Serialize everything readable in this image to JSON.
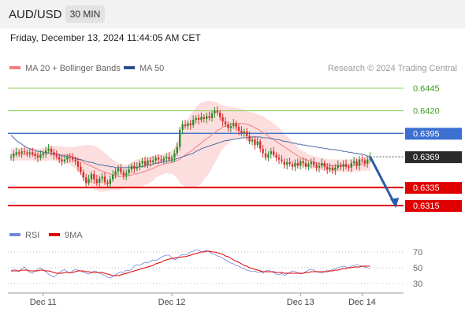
{
  "header": {
    "pair": "AUD/USD",
    "timeframe": "30 MIN"
  },
  "datetime": "Friday, December 13, 2024 11:44:05 AM CET",
  "watermark": "Research © 2024 Trading Central",
  "colors": {
    "resistance": "#8ccf5a",
    "pivot": "#3b6fd1",
    "support": "#e00000",
    "current": "#2b2b2b",
    "up": "#2f8a2f",
    "down": "#d92e2e",
    "ma20": "#f08080",
    "ma50": "#4d6fa8",
    "band": "#fdd8d8",
    "rsi": "#6f88d8",
    "ma9": "#e00000",
    "arrow": "#2a5caa"
  },
  "chart_data": [
    {
      "type": "candlestick",
      "legend": [
        {
          "label": "MA 20 + Bollinger Bands",
          "color": "#f08080"
        },
        {
          "label": "MA 50",
          "color": "#2a4f8f"
        }
      ],
      "ylim": [
        0.6308,
        0.6452
      ],
      "x_ticks": [
        {
          "i": 12,
          "label": "Dec 11"
        },
        {
          "i": 60,
          "label": "Dec 12"
        },
        {
          "i": 108,
          "label": "Dec 13"
        },
        {
          "i": 131,
          "label": "Dec 14"
        }
      ],
      "levels": [
        {
          "value": 0.6445,
          "label": "0.6445",
          "kind": "resistance"
        },
        {
          "value": 0.642,
          "label": "0.6420",
          "kind": "resistance"
        },
        {
          "value": 0.6395,
          "label": "0.6395",
          "kind": "pivot"
        },
        {
          "value": 0.6369,
          "label": "0.6369",
          "kind": "current"
        },
        {
          "value": 0.6335,
          "label": "0.6335",
          "kind": "support"
        },
        {
          "value": 0.6315,
          "label": "0.6315",
          "kind": "support"
        }
      ],
      "close": [
        0.6369,
        0.6372,
        0.6374,
        0.6373,
        0.6375,
        0.6374,
        0.6373,
        0.6374,
        0.6372,
        0.637,
        0.6368,
        0.6371,
        0.6373,
        0.6376,
        0.6378,
        0.6374,
        0.6371,
        0.6369,
        0.6366,
        0.6364,
        0.6366,
        0.6369,
        0.6368,
        0.6366,
        0.6364,
        0.6358,
        0.6352,
        0.6346,
        0.634,
        0.6344,
        0.635,
        0.6344,
        0.634,
        0.6345,
        0.6347,
        0.6341,
        0.6339,
        0.6344,
        0.6349,
        0.6353,
        0.6356,
        0.6352,
        0.6348,
        0.6351,
        0.6355,
        0.6359,
        0.6356,
        0.6358,
        0.6362,
        0.6364,
        0.636,
        0.6365,
        0.6363,
        0.6365,
        0.6368,
        0.6366,
        0.6365,
        0.6367,
        0.6369,
        0.6366,
        0.6368,
        0.6373,
        0.638,
        0.6399,
        0.6405,
        0.6403,
        0.6406,
        0.6404,
        0.641,
        0.6412,
        0.641,
        0.6413,
        0.6411,
        0.6414,
        0.6412,
        0.6417,
        0.642,
        0.6418,
        0.6413,
        0.6408,
        0.6405,
        0.6401,
        0.6403,
        0.6406,
        0.6402,
        0.6398,
        0.6395,
        0.6397,
        0.6392,
        0.6386,
        0.6388,
        0.6382,
        0.6386,
        0.6378,
        0.6373,
        0.6368,
        0.6372,
        0.6375,
        0.6371,
        0.6368,
        0.6366,
        0.6364,
        0.636,
        0.6363,
        0.6361,
        0.6358,
        0.6362,
        0.6359,
        0.6364,
        0.6362,
        0.6358,
        0.6361,
        0.6363,
        0.636,
        0.6357,
        0.6359,
        0.6362,
        0.6358,
        0.6355,
        0.6357,
        0.6354,
        0.6357,
        0.636,
        0.6358,
        0.6361,
        0.6358,
        0.6357,
        0.6362,
        0.6364,
        0.6359,
        0.6366,
        0.6365,
        0.6362,
        0.6366,
        0.6369
      ],
      "ma20": [
        0.6371,
        0.6372,
        0.6372,
        0.6372,
        0.6372,
        0.6372,
        0.6372,
        0.6372,
        0.6372,
        0.6371,
        0.6371,
        0.6371,
        0.6372,
        0.6372,
        0.6373,
        0.6373,
        0.6373,
        0.6372,
        0.6372,
        0.6371,
        0.6371,
        0.6371,
        0.637,
        0.6369,
        0.6368,
        0.6367,
        0.6365,
        0.6363,
        0.6361,
        0.636,
        0.6359,
        0.6357,
        0.6356,
        0.6354,
        0.6353,
        0.6352,
        0.6351,
        0.635,
        0.6349,
        0.6348,
        0.6347,
        0.6347,
        0.6347,
        0.6347,
        0.6348,
        0.6349,
        0.635,
        0.635,
        0.6351,
        0.6352,
        0.6353,
        0.6354,
        0.6355,
        0.6356,
        0.6358,
        0.6359,
        0.636,
        0.6361,
        0.6362,
        0.6362,
        0.6363,
        0.6364,
        0.6365,
        0.6366,
        0.6369,
        0.6371,
        0.6373,
        0.6375,
        0.6377,
        0.638,
        0.6382,
        0.6384,
        0.6387,
        0.6389,
        0.6391,
        0.6394,
        0.6396,
        0.6398,
        0.64,
        0.6402,
        0.6403,
        0.6404,
        0.6405,
        0.6406,
        0.6406,
        0.6406,
        0.6406,
        0.6406,
        0.6405,
        0.6404,
        0.6403,
        0.6401,
        0.64,
        0.6398,
        0.6396,
        0.6394,
        0.6392,
        0.639,
        0.6388,
        0.6386,
        0.6384,
        0.6382,
        0.638,
        0.6378,
        0.6376,
        0.6374,
        0.6372,
        0.637,
        0.6368,
        0.6367,
        0.6366,
        0.6365,
        0.6364,
        0.6363,
        0.6362,
        0.6361,
        0.6361,
        0.636,
        0.636,
        0.6359,
        0.6359,
        0.6359,
        0.6359,
        0.6359,
        0.6359,
        0.6359,
        0.6359,
        0.6359,
        0.636,
        0.636,
        0.636,
        0.6361,
        0.6361,
        0.6362,
        0.6362
      ],
      "bb_upper": [
        0.6378,
        0.6379,
        0.6379,
        0.6379,
        0.6379,
        0.6379,
        0.6379,
        0.6379,
        0.6379,
        0.6378,
        0.6378,
        0.6378,
        0.6379,
        0.638,
        0.6381,
        0.6381,
        0.6381,
        0.6381,
        0.6381,
        0.6381,
        0.638,
        0.638,
        0.638,
        0.638,
        0.638,
        0.6381,
        0.6381,
        0.6382,
        0.6382,
        0.6382,
        0.6382,
        0.6381,
        0.638,
        0.6378,
        0.6376,
        0.6373,
        0.6371,
        0.6368,
        0.6366,
        0.6364,
        0.6362,
        0.6361,
        0.636,
        0.636,
        0.6361,
        0.6363,
        0.6365,
        0.6366,
        0.6367,
        0.6368,
        0.6368,
        0.6369,
        0.6369,
        0.637,
        0.637,
        0.6371,
        0.6371,
        0.6372,
        0.6373,
        0.6374,
        0.6376,
        0.638,
        0.6385,
        0.6392,
        0.64,
        0.6406,
        0.6411,
        0.6416,
        0.642,
        0.6424,
        0.6427,
        0.6429,
        0.643,
        0.6431,
        0.6431,
        0.6431,
        0.643,
        0.6429,
        0.6427,
        0.6426,
        0.6425,
        0.6425,
        0.6424,
        0.6424,
        0.6423,
        0.6423,
        0.6422,
        0.6421,
        0.642,
        0.6419,
        0.6418,
        0.6417,
        0.6416,
        0.6415,
        0.6414,
        0.6412,
        0.641,
        0.6408,
        0.6406,
        0.6404,
        0.6401,
        0.6398,
        0.6395,
        0.6392,
        0.6389,
        0.6386,
        0.6383,
        0.638,
        0.6377,
        0.6375,
        0.6374,
        0.6372,
        0.6371,
        0.637,
        0.6369,
        0.6368,
        0.6368,
        0.6367,
        0.6367,
        0.6366,
        0.6366,
        0.6366,
        0.6366,
        0.6366,
        0.6366,
        0.6366,
        0.6366,
        0.6366,
        0.6367,
        0.6367,
        0.6368,
        0.6368,
        0.6369,
        0.637,
        0.6371
      ],
      "bb_lower": [
        0.6364,
        0.6365,
        0.6365,
        0.6365,
        0.6365,
        0.6365,
        0.6365,
        0.6365,
        0.6365,
        0.6364,
        0.6364,
        0.6364,
        0.6365,
        0.6364,
        0.6365,
        0.6365,
        0.6365,
        0.6363,
        0.6363,
        0.6361,
        0.6362,
        0.6362,
        0.636,
        0.6358,
        0.6356,
        0.6353,
        0.6349,
        0.6344,
        0.634,
        0.6338,
        0.6336,
        0.6333,
        0.6332,
        0.633,
        0.633,
        0.6331,
        0.6331,
        0.6332,
        0.6332,
        0.6332,
        0.6332,
        0.6333,
        0.6334,
        0.6334,
        0.6335,
        0.6335,
        0.6335,
        0.6334,
        0.6335,
        0.6336,
        0.6338,
        0.6339,
        0.6341,
        0.6342,
        0.6346,
        0.6347,
        0.6349,
        0.635,
        0.6351,
        0.635,
        0.635,
        0.6348,
        0.6345,
        0.634,
        0.6338,
        0.6336,
        0.6335,
        0.6334,
        0.6334,
        0.6336,
        0.6337,
        0.6339,
        0.6344,
        0.6347,
        0.6351,
        0.6357,
        0.6362,
        0.6367,
        0.6373,
        0.6378,
        0.6381,
        0.6383,
        0.6386,
        0.6388,
        0.6389,
        0.6389,
        0.639,
        0.6391,
        0.639,
        0.6389,
        0.6388,
        0.6385,
        0.6384,
        0.6381,
        0.6378,
        0.6376,
        0.6374,
        0.6372,
        0.637,
        0.6368,
        0.6367,
        0.6366,
        0.6365,
        0.6364,
        0.6363,
        0.6362,
        0.6361,
        0.636,
        0.6359,
        0.6359,
        0.6358,
        0.6358,
        0.6357,
        0.6356,
        0.6355,
        0.6354,
        0.6354,
        0.6353,
        0.6353,
        0.6352,
        0.6352,
        0.6352,
        0.6352,
        0.6352,
        0.6352,
        0.6352,
        0.6352,
        0.6352,
        0.6353,
        0.6353,
        0.6352,
        0.6354,
        0.6353,
        0.6354,
        0.6353
      ],
      "ma50": [
        0.6393,
        0.639,
        0.6387,
        0.6385,
        0.6383,
        0.6381,
        0.6379,
        0.6378,
        0.6377,
        0.6376,
        0.6375,
        0.6375,
        0.6374,
        0.6374,
        0.6373,
        0.6373,
        0.6372,
        0.6372,
        0.6371,
        0.637,
        0.637,
        0.6369,
        0.6369,
        0.6368,
        0.6367,
        0.6366,
        0.6366,
        0.6365,
        0.6364,
        0.6363,
        0.6363,
        0.6362,
        0.6361,
        0.636,
        0.636,
        0.6359,
        0.6359,
        0.6358,
        0.6358,
        0.6357,
        0.6357,
        0.6357,
        0.6357,
        0.6357,
        0.6357,
        0.6357,
        0.6357,
        0.6357,
        0.6358,
        0.6358,
        0.6359,
        0.636,
        0.636,
        0.6361,
        0.6362,
        0.6362,
        0.6363,
        0.6364,
        0.6364,
        0.6365,
        0.6365,
        0.6366,
        0.6367,
        0.6368,
        0.6369,
        0.637,
        0.6371,
        0.6372,
        0.6373,
        0.6375,
        0.6376,
        0.6378,
        0.6379,
        0.638,
        0.6381,
        0.6382,
        0.6383,
        0.6384,
        0.6385,
        0.6386,
        0.6387,
        0.6387,
        0.6388,
        0.6388,
        0.6389,
        0.6389,
        0.639,
        0.639,
        0.639,
        0.6391,
        0.6391,
        0.6391,
        0.6391,
        0.6391,
        0.639,
        0.639,
        0.639,
        0.6389,
        0.6389,
        0.6388,
        0.6388,
        0.6387,
        0.6386,
        0.6386,
        0.6385,
        0.6384,
        0.6384,
        0.6383,
        0.6383,
        0.6382,
        0.6382,
        0.6381,
        0.6381,
        0.638,
        0.638,
        0.6379,
        0.6379,
        0.6378,
        0.6378,
        0.6377,
        0.6377,
        0.6377,
        0.6376,
        0.6376,
        0.6375,
        0.6375,
        0.6374,
        0.6374,
        0.6373,
        0.6373,
        0.6372,
        0.6372,
        0.6371,
        0.637,
        0.6369
      ],
      "forecast": [
        {
          "i": 134,
          "value": 0.6369
        },
        {
          "i": 143,
          "value": 0.6315
        }
      ]
    },
    {
      "type": "line",
      "legend": [
        {
          "label": "RSI",
          "color": "#6f88d8"
        },
        {
          "label": "9MA",
          "color": "#e00000"
        }
      ],
      "ylim": [
        22,
        78
      ],
      "y_ticks": [
        {
          "value": 70,
          "label": "70"
        },
        {
          "value": 50,
          "label": "50"
        },
        {
          "value": 30,
          "label": "30"
        }
      ],
      "rsi": [
        46,
        48,
        47,
        45,
        49,
        51,
        47,
        44,
        43,
        46,
        48,
        50,
        47,
        45,
        42,
        40,
        38,
        41,
        44,
        46,
        48,
        45,
        43,
        46,
        48,
        47,
        46,
        44,
        43,
        42,
        44,
        46,
        45,
        43,
        42,
        40,
        38,
        37,
        39,
        41,
        43,
        45,
        44,
        47,
        46,
        48,
        52,
        54,
        53,
        55,
        57,
        56,
        58,
        60,
        59,
        61,
        63,
        65,
        66,
        66,
        63,
        60,
        62,
        65,
        67,
        66,
        68,
        70,
        71,
        73,
        72,
        70,
        71,
        72,
        70,
        68,
        67,
        65,
        64,
        62,
        60,
        58,
        56,
        55,
        53,
        52,
        50,
        49,
        47,
        46,
        45,
        46,
        44,
        45,
        43,
        46,
        47,
        45,
        44,
        42,
        41,
        43,
        40,
        42,
        44,
        46,
        45,
        44,
        42,
        43,
        45,
        47,
        48,
        47,
        45,
        44,
        43,
        45,
        47,
        46,
        48,
        49,
        50,
        51,
        52,
        51,
        50,
        52,
        53,
        54,
        53,
        52,
        51,
        50,
        49
      ],
      "ma9": [
        46,
        46,
        46,
        46,
        47,
        47,
        47,
        46,
        46,
        46,
        46,
        47,
        47,
        46,
        46,
        45,
        44,
        43,
        43,
        43,
        44,
        44,
        44,
        44,
        45,
        46,
        46,
        46,
        45,
        45,
        44,
        44,
        44,
        44,
        44,
        43,
        42,
        41,
        40,
        40,
        40,
        41,
        42,
        43,
        44,
        45,
        46,
        47,
        48,
        49,
        50,
        51,
        52,
        53,
        55,
        56,
        57,
        59,
        60,
        61,
        62,
        62,
        63,
        63,
        64,
        64,
        65,
        66,
        67,
        68,
        69,
        70,
        70,
        71,
        71,
        70,
        70,
        69,
        68,
        67,
        65,
        64,
        62,
        60,
        58,
        57,
        55,
        53,
        52,
        50,
        49,
        48,
        47,
        46,
        45,
        45,
        45,
        45,
        45,
        44,
        44,
        44,
        43,
        43,
        43,
        43,
        43,
        43,
        43,
        43,
        44,
        44,
        45,
        45,
        45,
        45,
        45,
        45,
        45,
        46,
        46,
        47,
        47,
        48,
        49,
        49,
        50,
        50,
        51,
        51,
        51,
        52,
        52,
        52,
        52
      ]
    }
  ]
}
